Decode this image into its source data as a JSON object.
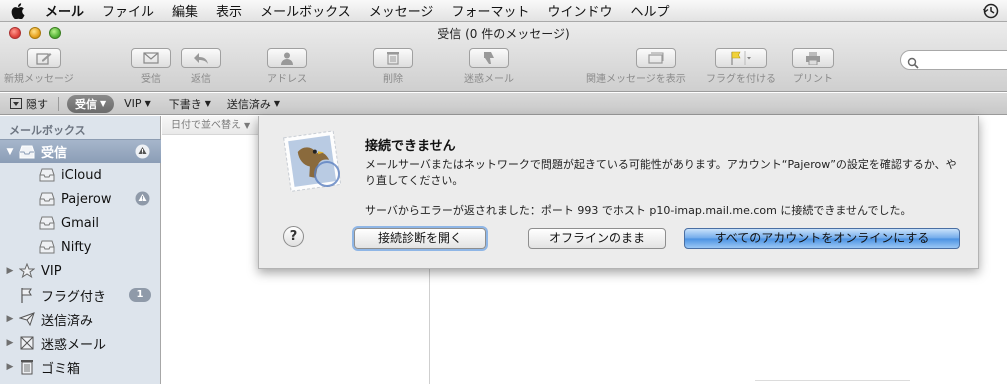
{
  "menubar": {
    "items": [
      "メール",
      "ファイル",
      "編集",
      "表示",
      "メールボックス",
      "メッセージ",
      "フォーマット",
      "ウインドウ",
      "ヘルプ"
    ]
  },
  "window": {
    "title": "受信 (0 件のメッセージ)"
  },
  "toolbar": {
    "new_message": "新規メッセージ",
    "get_mail": "受信",
    "reply": "返信",
    "address": "アドレス",
    "delete": "削除",
    "junk": "迷惑メール",
    "show_related": "関連メッセージを表示",
    "flag": "フラグを付ける",
    "print": "プリント",
    "search_placeholder": ""
  },
  "favorites": {
    "hide": "隠す",
    "inbox": "受信",
    "vip": "VIP",
    "drafts": "下書き",
    "sent": "送信済み"
  },
  "sidebar": {
    "header": "メールボックス",
    "items": [
      {
        "label": "受信",
        "icon": "inbox-icon",
        "selected": true,
        "warn": true
      },
      {
        "label": "iCloud",
        "icon": "inbox-tray-icon"
      },
      {
        "label": "Pajerow",
        "icon": "inbox-tray-icon",
        "warn": true
      },
      {
        "label": "Gmail",
        "icon": "inbox-tray-icon"
      },
      {
        "label": "Nifty",
        "icon": "inbox-tray-icon"
      },
      {
        "label": "VIP",
        "icon": "star-icon"
      },
      {
        "label": "フラグ付き",
        "icon": "flag-icon",
        "badge": "1"
      },
      {
        "label": "送信済み",
        "icon": "paper-plane-icon"
      },
      {
        "label": "迷惑メール",
        "icon": "junk-icon"
      },
      {
        "label": "ゴミ箱",
        "icon": "trash-icon"
      }
    ]
  },
  "list": {
    "sort_label": "日付で並べ替え"
  },
  "alert": {
    "title": "接続できません",
    "message": "メールサーバまたはネットワークで問題が起きている可能性があります。アカウント“Pajerow”の設定を確認するか、やり直してください。",
    "error": "サーバからエラーが返されました：ポート 993 でホスト p10-imap.mail.me.com に接続できませんでした。",
    "help": "?",
    "btn_diagnostics": "接続診断を開く",
    "btn_offline": "オフラインのまま",
    "btn_online_all": "すべてのアカウントをオンラインにする"
  },
  "colors": {
    "accent": "#4a91e2",
    "sidebar_bg": "#dde4ec",
    "selection": "#8b9db6"
  }
}
